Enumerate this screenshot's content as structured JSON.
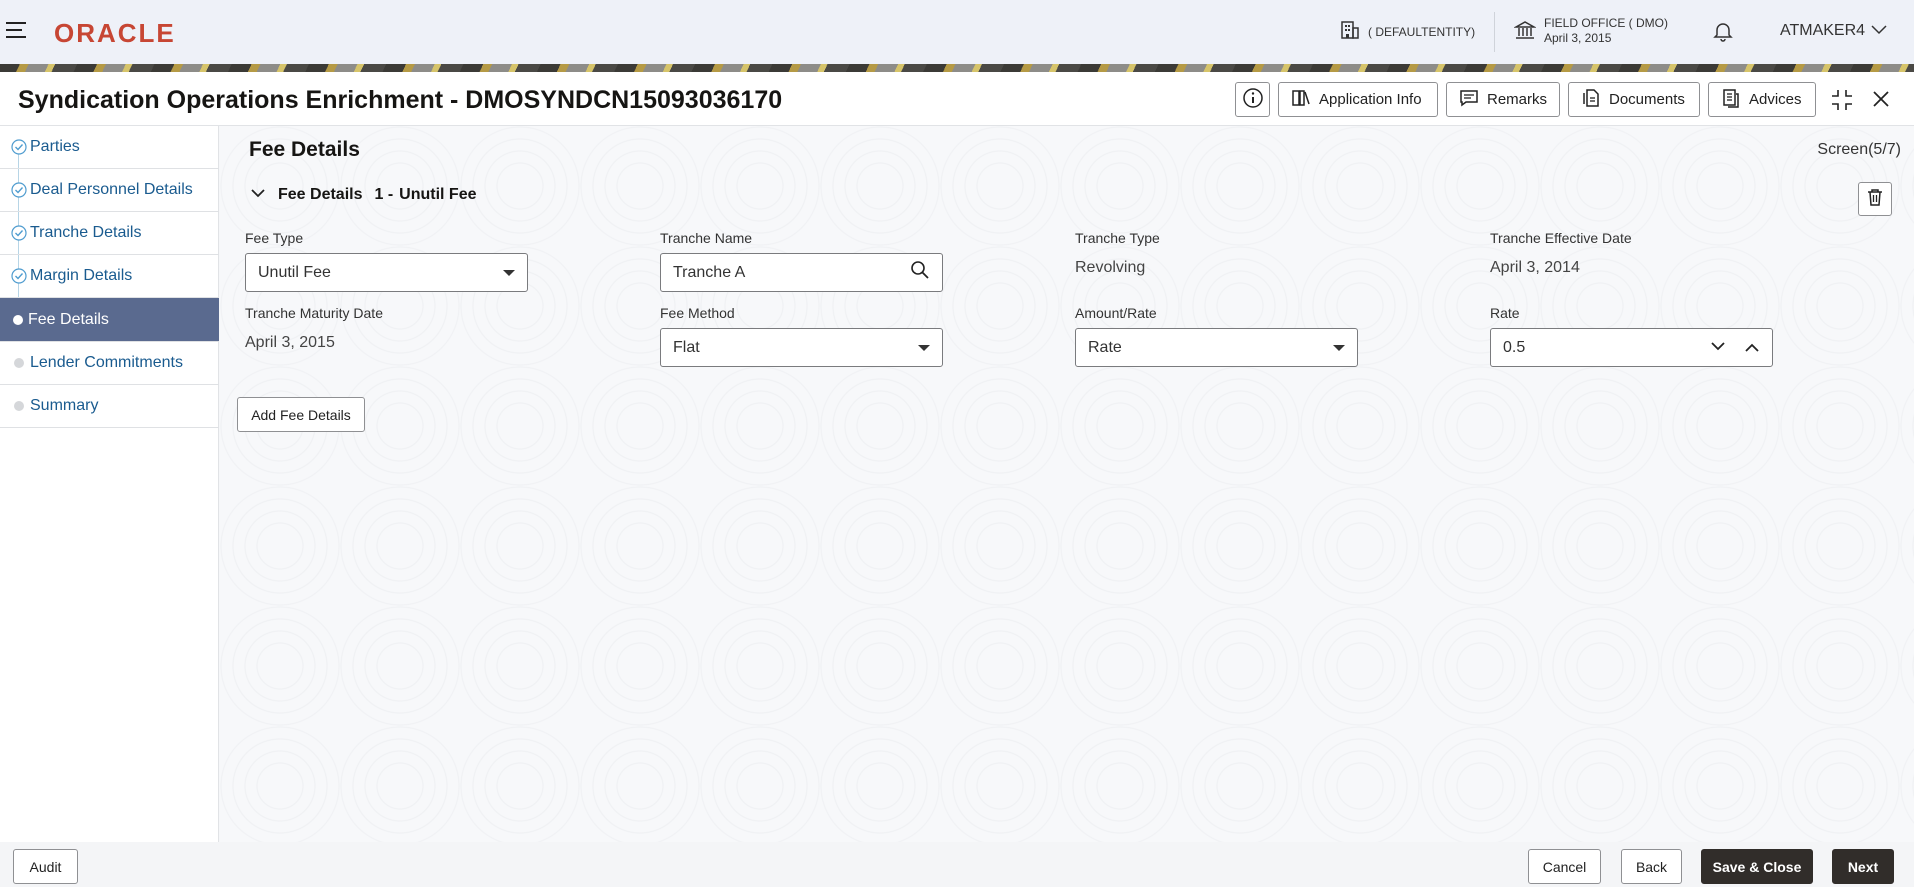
{
  "header": {
    "logo": "ORACLE",
    "entity": "( DEFAULTENTITY)",
    "office_line1": "FIELD OFFICE ( DMO)",
    "office_line2": "April 3, 2015",
    "user": "ATMAKER4"
  },
  "titlebar": {
    "title": "Syndication Operations Enrichment - DMOSYNDCN15093036170",
    "buttons": {
      "application_info": "Application Info",
      "remarks": "Remarks",
      "documents": "Documents",
      "advices": "Advices"
    }
  },
  "sidebar": {
    "steps": [
      {
        "label": "Parties",
        "state": "done"
      },
      {
        "label": "Deal Personnel Details",
        "state": "done"
      },
      {
        "label": "Tranche Details",
        "state": "done"
      },
      {
        "label": "Margin Details",
        "state": "done"
      },
      {
        "label": "Fee Details",
        "state": "active"
      },
      {
        "label": "Lender Commitments",
        "state": "pending"
      },
      {
        "label": "Summary",
        "state": "pending"
      }
    ]
  },
  "content": {
    "section_title": "Fee Details",
    "screen_count": "Screen(5/7)",
    "accordion": {
      "title": "Fee Details",
      "index": "1 -",
      "name": "Unutil Fee"
    },
    "fields": {
      "fee_type": {
        "label": "Fee Type",
        "value": "Unutil Fee"
      },
      "tranche_name": {
        "label": "Tranche Name",
        "value": "Tranche A"
      },
      "tranche_type": {
        "label": "Tranche Type",
        "value": "Revolving"
      },
      "tranche_effective_date": {
        "label": "Tranche Effective Date",
        "value": "April 3, 2014"
      },
      "tranche_maturity_date": {
        "label": "Tranche Maturity Date",
        "value": "April 3, 2015"
      },
      "fee_method": {
        "label": "Fee Method",
        "value": "Flat"
      },
      "amount_rate": {
        "label": "Amount/Rate",
        "value": "Rate"
      },
      "rate": {
        "label": "Rate",
        "value": "0.5"
      }
    },
    "add_fee_button": "Add Fee Details"
  },
  "footer": {
    "audit": "Audit",
    "cancel": "Cancel",
    "back": "Back",
    "save_close": "Save & Close",
    "next": "Next"
  },
  "colors": {
    "brand_red": "#c74634",
    "active_step": "#5a6a8f",
    "link_blue": "#1a5b8f",
    "primary_button": "#312d2a"
  }
}
